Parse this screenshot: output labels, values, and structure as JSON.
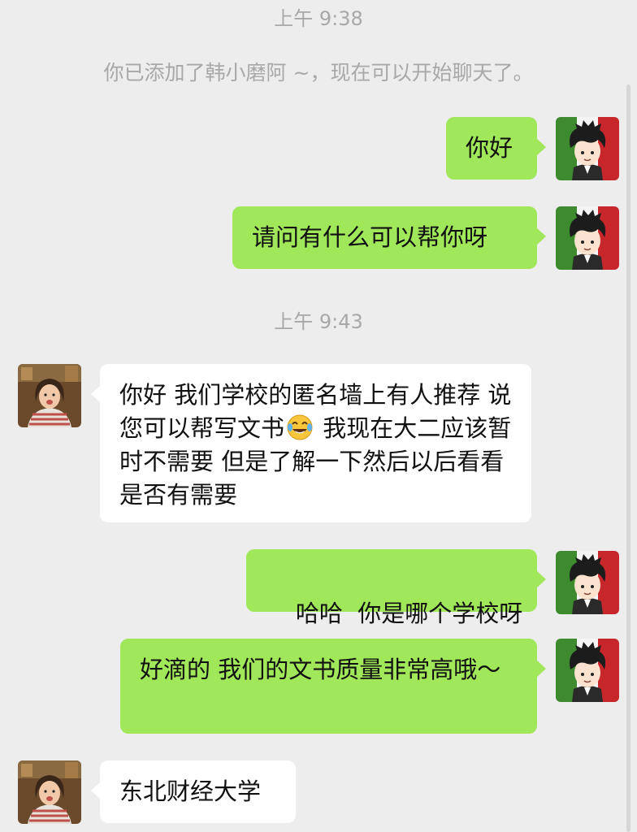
{
  "chat": {
    "timestamp_1": "上午 9:38",
    "system_notice": "你已添加了韩小磨阿 ~，现在可以开始聊天了。",
    "timestamp_2": "上午 9:43",
    "messages": [
      {
        "sender": "me",
        "text": "你好"
      },
      {
        "sender": "me",
        "text": "请问有什么可以帮你呀"
      },
      {
        "sender": "contact",
        "text_a": "你好 我们学校的匿名墙上有人推荐 说您可以帮写文书",
        "emoji": "face-with-tears-of-joy-icon",
        "text_b": " 我现在大二应该暂时不需要 但是了解一下然后以后看看是否有需要"
      },
      {
        "sender": "me",
        "text": "哈哈  你是哪个学校呀"
      },
      {
        "sender": "me",
        "text": "好滴的 我们的文书质量非常高哦～"
      },
      {
        "sender": "contact",
        "text": "东北财经大学"
      }
    ]
  },
  "colors": {
    "background": "#ededed",
    "outgoing_bubble": "#a0e75a",
    "incoming_bubble": "#ffffff",
    "timestamp_text": "#a8a8a8"
  }
}
